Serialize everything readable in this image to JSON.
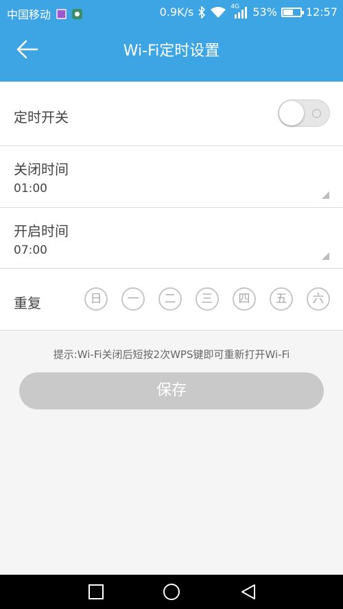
{
  "status_bar": {
    "carrier": "中国移动",
    "speed": "0.9K/s",
    "network": "4G",
    "battery": "53%",
    "time": "12:57"
  },
  "header": {
    "title": "Wi-Fi定时设置",
    "color": "#3ea5e5"
  },
  "timer_switch": {
    "label": "定时开关",
    "enabled": false
  },
  "close_time": {
    "label": "关闭时间",
    "value": "01:00"
  },
  "open_time": {
    "label": "开启时间",
    "value": "07:00"
  },
  "repeat": {
    "label": "重复",
    "days": [
      "日",
      "一",
      "二",
      "三",
      "四",
      "五",
      "六"
    ]
  },
  "hint": "提示:Wi-Fi关闭后短按2次WPS键即可重新打开Wi-Fi",
  "save_label": "保存",
  "nav_icons": [
    "square-icon",
    "circle-icon",
    "triangle-back-icon"
  ]
}
